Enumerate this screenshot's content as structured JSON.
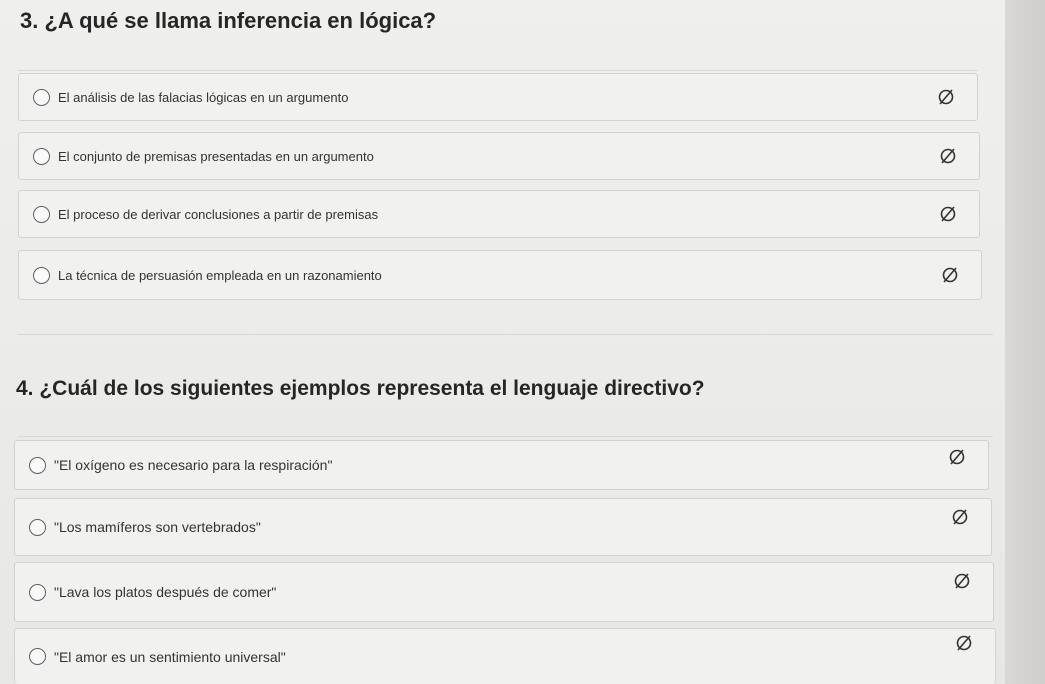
{
  "questions": [
    {
      "title": "3. ¿A qué se llama inferencia en lógica?",
      "options": [
        {
          "label": "El análisis de las falacias lógicas en un argumento"
        },
        {
          "label": "El conjunto de premisas presentadas en un argumento"
        },
        {
          "label": "El proceso de derivar conclusiones a partir de premisas"
        },
        {
          "label": "La técnica de persuasión empleada en un razonamiento"
        }
      ]
    },
    {
      "title": "4. ¿Cuál de los siguientes ejemplos representa el lenguaje directivo?",
      "options": [
        {
          "label": "\"El oxígeno es necesario para la respiración\""
        },
        {
          "label": "\"Los mamíferos son vertebrados\""
        },
        {
          "label": "\"Lava los platos después de comer\""
        },
        {
          "label": "\"El amor es un sentimiento universal\""
        }
      ]
    }
  ],
  "icons": {
    "radio": "radio-unselected-icon",
    "strikethrough": "strikethrough-icon"
  },
  "colors": {
    "background": "#ebebe9",
    "option_border": "#d2d2cf",
    "text": "#2b2b2b"
  }
}
